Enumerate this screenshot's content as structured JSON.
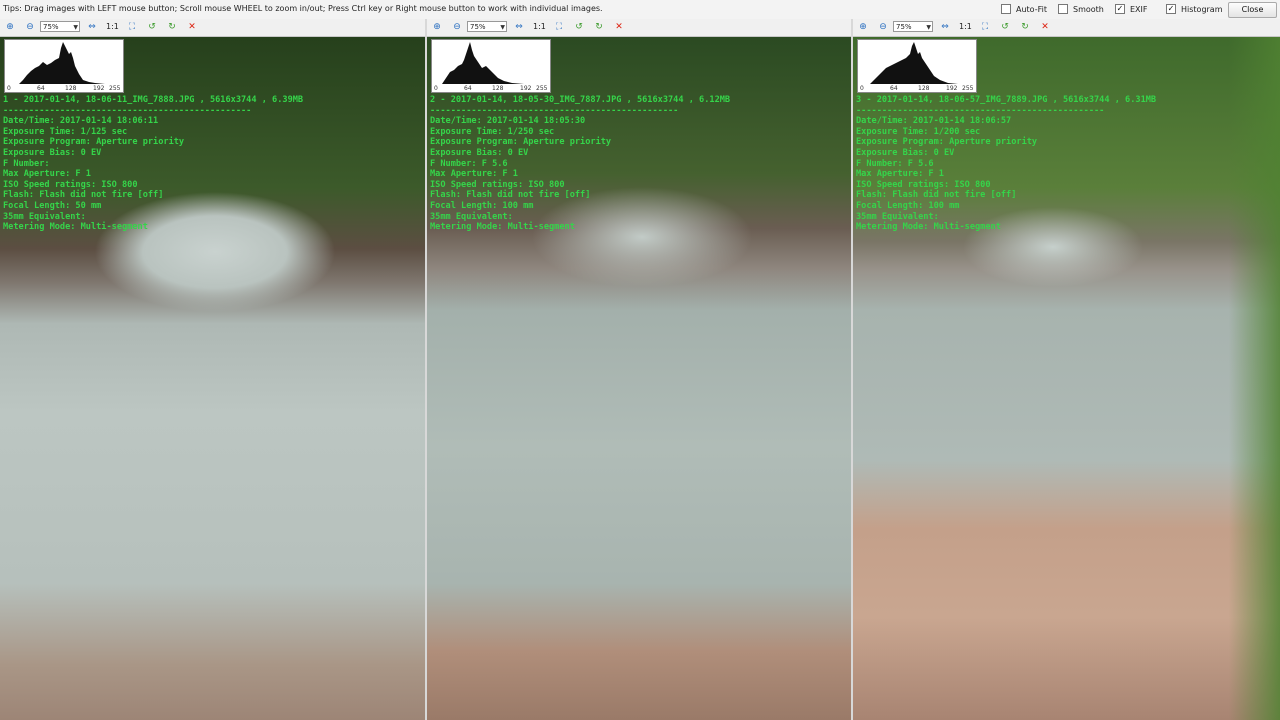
{
  "tip": "Tips: Drag images with LEFT mouse button; Scroll mouse WHEEL to zoom in/out; Press Ctrl key or Right mouse button to work with individual images.",
  "options": {
    "autofit": {
      "label": "Auto-Fit",
      "checked": false
    },
    "smooth": {
      "label": "Smooth",
      "checked": false
    },
    "exif": {
      "label": "EXIF",
      "checked": true
    },
    "histogram": {
      "label": "Histogram",
      "checked": true
    }
  },
  "close_label": "Close",
  "zoom_value": "75%",
  "one_to_one": "1:1",
  "hist_ticks": [
    "0",
    "64",
    "128",
    "192",
    "255"
  ],
  "panes": [
    {
      "title": "1 - 2017-01-14, 18-06-11_IMG_7888.JPG , 5616x3744 , 6.39MB",
      "separator": "------------------------------------------------",
      "datetime": "Date/Time: 2017-01-14 18:06:11",
      "exposure_time": "Exposure Time: 1/125 sec",
      "exposure_program": "Exposure Program: Aperture priority",
      "exposure_bias": "Exposure Bias: 0 EV",
      "f_number": "F Number:",
      "max_aperture": "Max Aperture: F 1",
      "iso": "ISO Speed ratings: ISO 800",
      "flash": "Flash: Flash did not fire [off]",
      "focal_length": "Focal Length: 50 mm",
      "equiv": "35mm Equivalent:",
      "metering": "Metering Mode: Multi-segment"
    },
    {
      "title": "2 - 2017-01-14, 18-05-30_IMG_7887.JPG , 5616x3744 , 6.12MB",
      "separator": "------------------------------------------------",
      "datetime": "Date/Time: 2017-01-14 18:05:30",
      "exposure_time": "Exposure Time: 1/250 sec",
      "exposure_program": "Exposure Program: Aperture priority",
      "exposure_bias": "Exposure Bias: 0 EV",
      "f_number": "F Number: F 5.6",
      "max_aperture": "Max Aperture: F 1",
      "iso": "ISO Speed ratings: ISO 800",
      "flash": "Flash: Flash did not fire [off]",
      "focal_length": "Focal Length: 100 mm",
      "equiv": "35mm Equivalent:",
      "metering": "Metering Mode: Multi-segment"
    },
    {
      "title": "3 - 2017-01-14, 18-06-57_IMG_7889.JPG , 5616x3744 , 6.31MB",
      "separator": "------------------------------------------------",
      "datetime": "Date/Time: 2017-01-14 18:06:57",
      "exposure_time": "Exposure Time: 1/200 sec",
      "exposure_program": "Exposure Program: Aperture priority",
      "exposure_bias": "Exposure Bias: 0 EV",
      "f_number": "F Number: F 5.6",
      "max_aperture": "Max Aperture: F 1",
      "iso": "ISO Speed ratings: ISO 800",
      "flash": "Flash: Flash did not fire [off]",
      "focal_length": "Focal Length: 100 mm",
      "equiv": "35mm Equivalent:",
      "metering": "Metering Mode: Multi-segment"
    }
  ]
}
